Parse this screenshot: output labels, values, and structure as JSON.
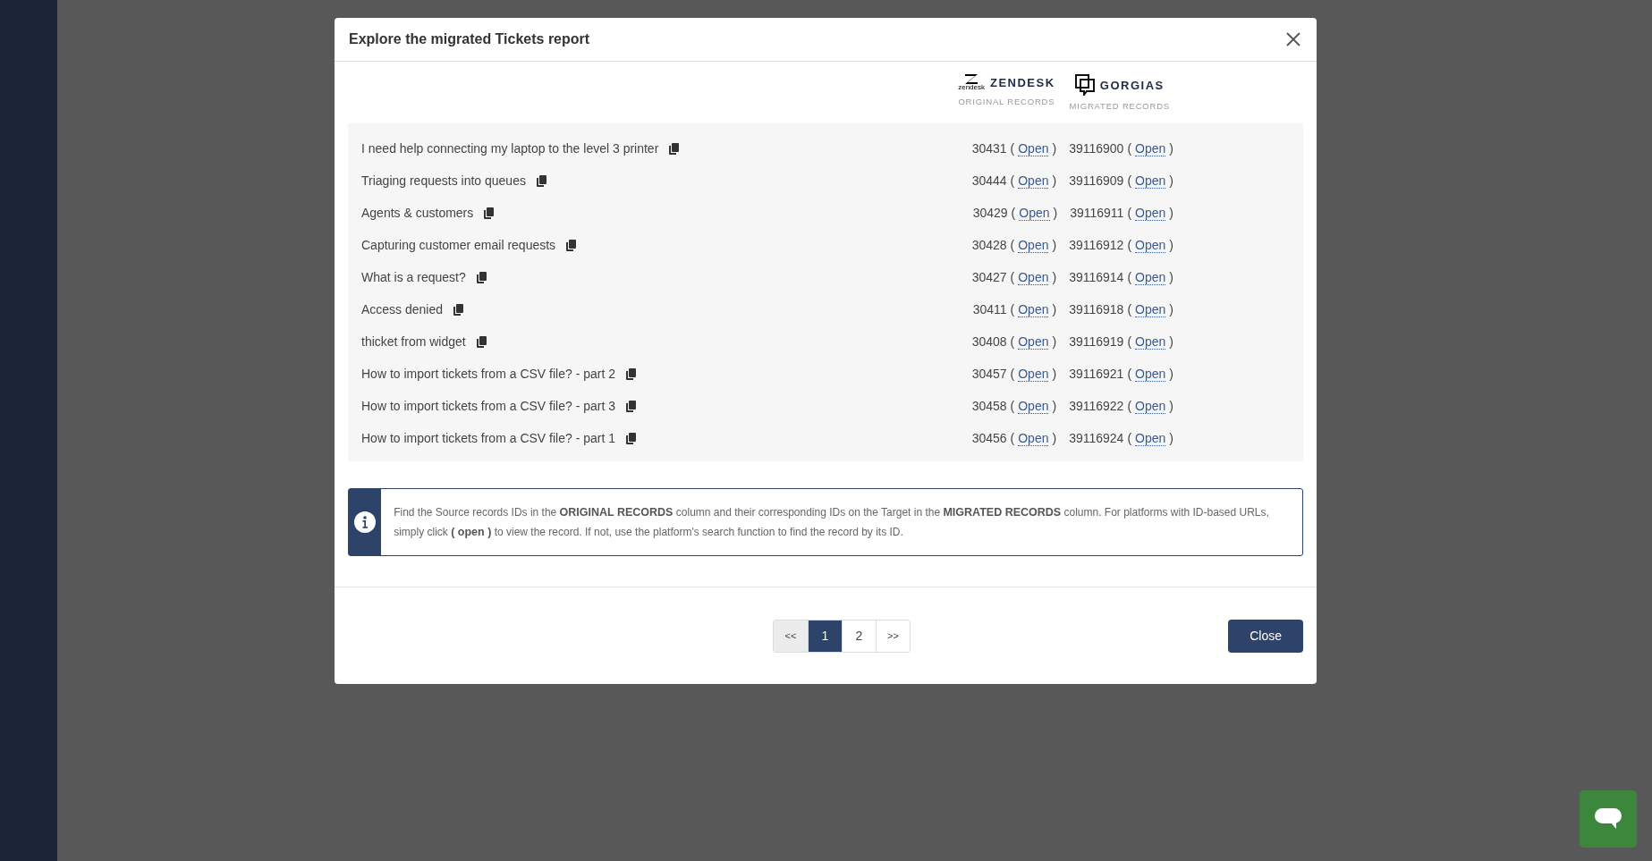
{
  "modal": {
    "title": "Explore the migrated Tickets report",
    "platforms": [
      {
        "kind": "zendesk",
        "name": "ZENDESK",
        "mark_caption": "zendesk",
        "caption": "ORIGINAL RECORDS"
      },
      {
        "kind": "gorgias",
        "name": "GORGIAS",
        "caption": "MIGRATED RECORDS"
      }
    ],
    "rows": [
      {
        "title": "I need help connecting my laptop to the level 3 printer",
        "ids": [
          {
            "id": "30431",
            "l": "(",
            "link": "Open",
            "r": ")"
          },
          {
            "id": "39116900",
            "l": "(",
            "link": "Open",
            "r": ")"
          }
        ]
      },
      {
        "title": "Triaging requests into queues",
        "ids": [
          {
            "id": "30444",
            "l": "(",
            "link": "Open",
            "r": ")"
          },
          {
            "id": "39116909",
            "l": "(",
            "link": "Open",
            "r": ")"
          }
        ]
      },
      {
        "title": "Agents & customers",
        "ids": [
          {
            "id": "30429",
            "l": "(",
            "link": "Open",
            "r": ")"
          },
          {
            "id": "39116911",
            "l": "(",
            "link": "Open",
            "r": ")"
          }
        ]
      },
      {
        "title": "Capturing customer email requests",
        "ids": [
          {
            "id": "30428",
            "l": "(",
            "link": "Open",
            "r": ")"
          },
          {
            "id": "39116912",
            "l": "(",
            "link": "Open",
            "r": ")"
          }
        ]
      },
      {
        "title": "What is a request?",
        "ids": [
          {
            "id": "30427",
            "l": "(",
            "link": "Open",
            "r": ")"
          },
          {
            "id": "39116914",
            "l": "(",
            "link": "Open",
            "r": ")"
          }
        ]
      },
      {
        "title": "Access denied",
        "ids": [
          {
            "id": "30411",
            "l": "(",
            "link": "Open",
            "r": ")"
          },
          {
            "id": "39116918",
            "l": "(",
            "link": "Open",
            "r": ")"
          }
        ]
      },
      {
        "title": "thicket from widget",
        "ids": [
          {
            "id": "30408",
            "l": "(",
            "link": "Open",
            "r": ")"
          },
          {
            "id": "39116919",
            "l": "(",
            "link": "Open",
            "r": ")"
          }
        ]
      },
      {
        "title": "How to import tickets from a CSV file? - part 2",
        "ids": [
          {
            "id": "30457",
            "l": "(",
            "link": "Open",
            "r": ")"
          },
          {
            "id": "39116921",
            "l": "(",
            "link": "Open",
            "r": ")"
          }
        ]
      },
      {
        "title": "How to import tickets from a CSV file? - part 3",
        "ids": [
          {
            "id": "30458",
            "l": "(",
            "link": "Open",
            "r": ")"
          },
          {
            "id": "39116922",
            "l": "(",
            "link": "Open",
            "r": ")"
          }
        ]
      },
      {
        "title": "How to import tickets from a CSV file? - part 1",
        "ids": [
          {
            "id": "30456",
            "l": "(",
            "link": "Open",
            "r": ")"
          },
          {
            "id": "39116924",
            "l": "(",
            "link": "Open",
            "r": ")"
          }
        ]
      }
    ],
    "info": "Find the Source records IDs in the **ORIGINAL RECORDS** column and their corresponding IDs on the Target in the **MIGRATED RECORDS** column. For platforms with ID-based URLs, simply click **( open )** to view the record. If not, use the platform's search function to find the record by its ID.",
    "pagination": {
      "prev": {
        "label": "<<",
        "disabled": true
      },
      "pages": [
        {
          "label": "1",
          "selected": true
        },
        {
          "label": "2",
          "selected": false
        }
      ],
      "next": {
        "label": ">>",
        "disabled": false
      }
    },
    "close_button": "Close"
  }
}
